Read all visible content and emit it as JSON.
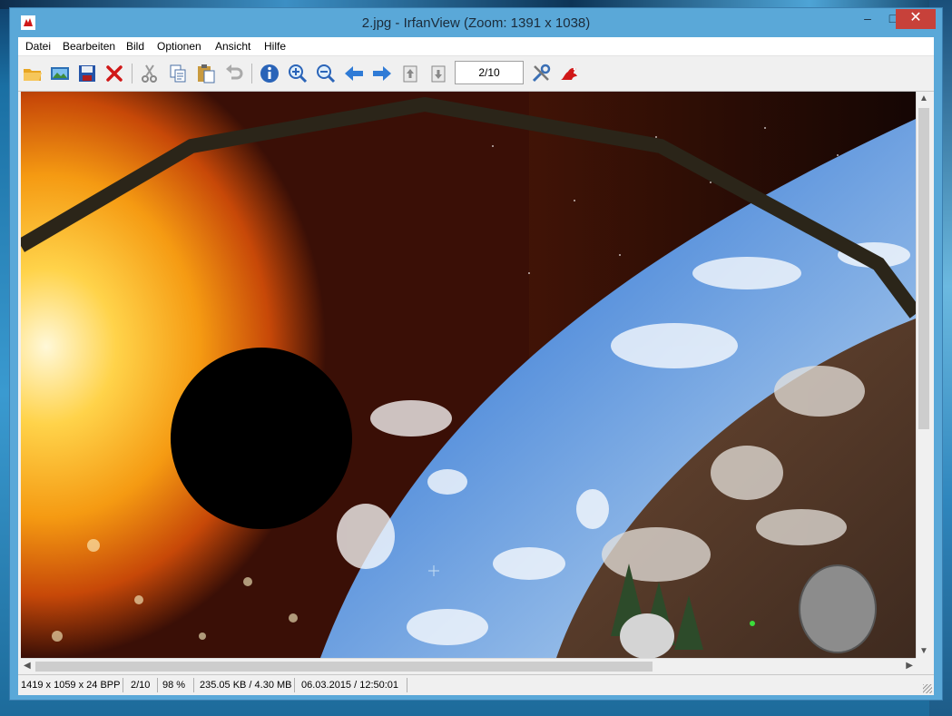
{
  "window": {
    "title": "2.jpg - IrfanView (Zoom: 1391 x 1038)",
    "minimize_label": "–",
    "maximize_label": "□",
    "close_label": "✕"
  },
  "menu": [
    {
      "label": "Datei"
    },
    {
      "label": "Bearbeiten"
    },
    {
      "label": "Bild"
    },
    {
      "label": "Optionen"
    },
    {
      "label": "Ansicht"
    },
    {
      "label": "Hilfe"
    }
  ],
  "toolbar": {
    "buttons": [
      "open-folder-icon",
      "thumbnails-icon",
      "save-icon",
      "delete-icon",
      "cut-icon",
      "copy-icon",
      "paste-icon",
      "undo-icon",
      "info-icon",
      "zoom-in-icon",
      "zoom-out-icon",
      "previous-icon",
      "next-icon",
      "first-page-icon",
      "last-page-icon"
    ],
    "page_value": "2/10",
    "extra_buttons": [
      "settings-icon",
      "irfanview-logo-icon"
    ]
  },
  "image": {
    "description_colors": {
      "sun": "#f6a21a",
      "space": "#2a0d07",
      "planet": "#4f83cf",
      "ring": "#2b2519"
    }
  },
  "status": {
    "dimensions": "1419 x 1059 x 24 BPP",
    "page": "2/10",
    "zoom": "98 %",
    "size": "235.05 KB / 4.30 MB",
    "datetime": "06.03.2015 / 12:50:01"
  },
  "colors": {
    "title_bar": "#5aa8d8",
    "close_button": "#c7413a"
  }
}
